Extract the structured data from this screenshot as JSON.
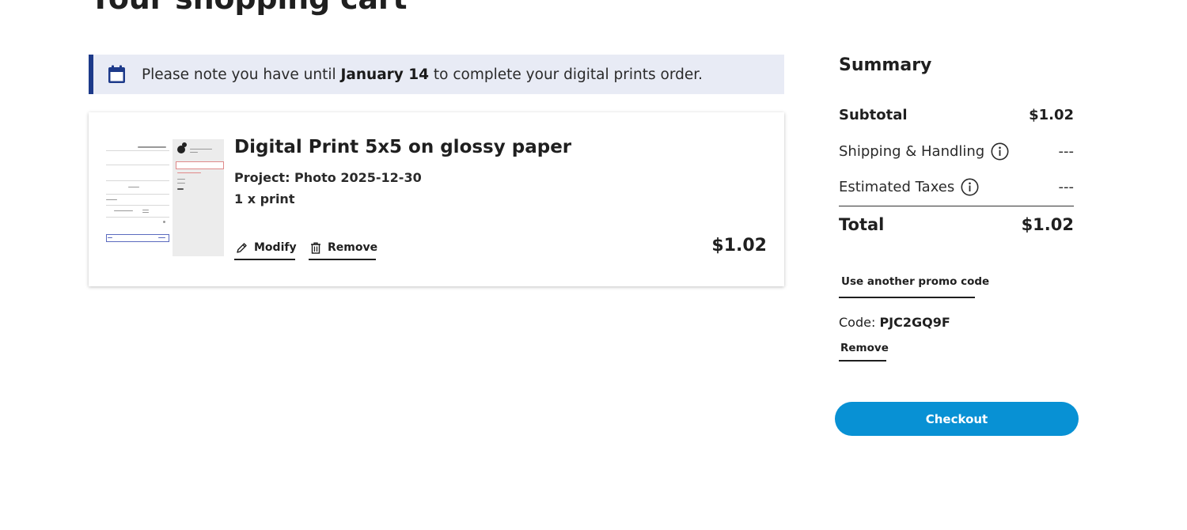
{
  "page": {
    "title": "Your shopping cart"
  },
  "notice": {
    "icon": "calendar-icon",
    "prefix": "Please note you have until ",
    "date": "January 14",
    "suffix": " to complete your digital prints order.",
    "accent_color": "#1d3a8a",
    "background_color": "#e8ebf5"
  },
  "cart_item": {
    "title": "Digital Print 5x5 on glossy paper",
    "project": "Project: Photo 2025-12-30",
    "quantity": "1 x print",
    "modify_label": "Modify",
    "remove_label": "Remove",
    "price": "$1.02"
  },
  "summary": {
    "title": "Summary",
    "subtotal_label": "Subtotal",
    "subtotal_value": "$1.02",
    "shipping_label": "Shipping & Handling",
    "shipping_value": "---",
    "taxes_label": "Estimated Taxes",
    "taxes_value": "---",
    "total_label": "Total",
    "total_value": "$1.02",
    "promo_link": "Use another promo code",
    "code_label": "Code: ",
    "code_value": "PJC2GQ9F",
    "code_remove": "Remove",
    "checkout_label": "Checkout",
    "checkout_color": "#0891d4"
  }
}
